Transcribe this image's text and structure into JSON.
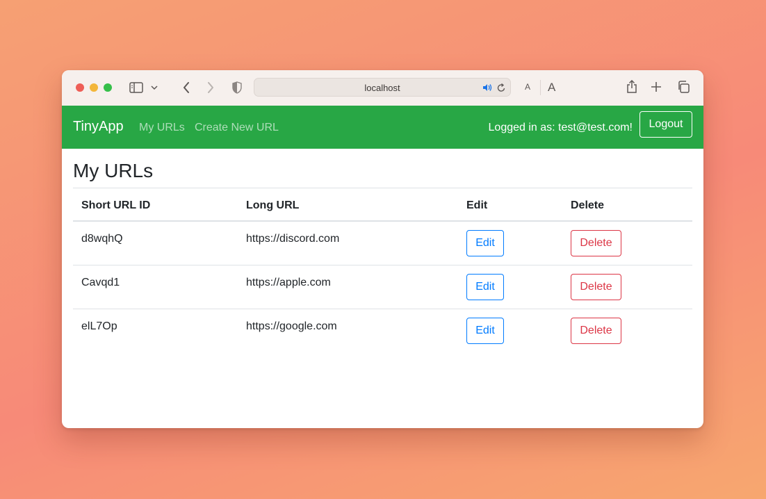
{
  "browser": {
    "address": "localhost",
    "text_size_small": "A",
    "text_size_large": "A"
  },
  "navbar": {
    "brand": "TinyApp",
    "links": [
      "My URLs",
      "Create New URL"
    ],
    "logged_in_text": "Logged in as: test@test.com!",
    "logout_label": "Logout",
    "background_color": "#28a745"
  },
  "page": {
    "title": "My URLs"
  },
  "table": {
    "headers": [
      "Short URL ID",
      "Long URL",
      "Edit",
      "Delete"
    ],
    "rows": [
      {
        "short_id": "d8wqhQ",
        "long_url": "https://discord.com",
        "edit_label": "Edit",
        "delete_label": "Delete"
      },
      {
        "short_id": "Cavqd1",
        "long_url": "https://apple.com",
        "edit_label": "Edit",
        "delete_label": "Delete"
      },
      {
        "short_id": "elL7Op",
        "long_url": "https://google.com",
        "edit_label": "Edit",
        "delete_label": "Delete"
      }
    ]
  },
  "colors": {
    "edit": "#007bff",
    "delete": "#dc3545"
  }
}
